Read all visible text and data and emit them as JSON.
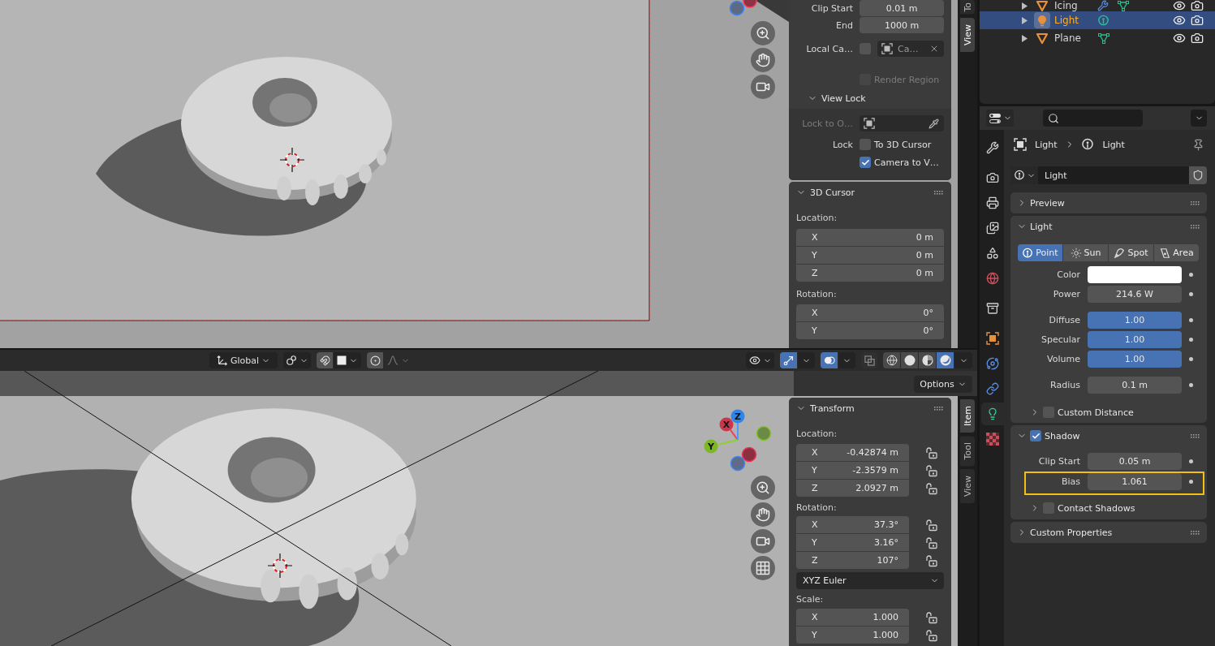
{
  "top_viewport": {
    "sidebar_tabs": [
      {
        "label": "To",
        "selected": false
      },
      {
        "label": "View",
        "selected": true
      }
    ],
    "view_panel": {
      "rows": [
        {
          "kind": "number",
          "label": "Clip Start",
          "value": "0.01 m"
        },
        {
          "kind": "number",
          "label": "End",
          "value": "1000 m"
        },
        {
          "kind": "object",
          "label": "Local Ca…",
          "checked": false,
          "value": "Ca…"
        },
        {
          "kind": "check",
          "text": "Render Region",
          "checked": false,
          "disabled": true
        }
      ],
      "subpanel": {
        "title": "View Lock",
        "expanded": true,
        "rows": [
          {
            "kind": "picker",
            "label": "Lock to O…",
            "disabled": true
          },
          {
            "kind": "check",
            "label": "Lock",
            "text": "To 3D Cursor",
            "checked": false,
            "disabled": false
          },
          {
            "kind": "check",
            "text": "Camera to V…",
            "checked": true,
            "disabled": false
          }
        ]
      }
    },
    "cursor_panel": {
      "title": "3D Cursor",
      "expanded": true,
      "groups": [
        {
          "label": "Location:",
          "fields": [
            {
              "axis": "X",
              "value": "0 m"
            },
            {
              "axis": "Y",
              "value": "0 m"
            },
            {
              "axis": "Z",
              "value": "0 m"
            }
          ]
        },
        {
          "label": "Rotation:",
          "fields": [
            {
              "axis": "X",
              "value": "0°"
            },
            {
              "axis": "Y",
              "value": "0°"
            }
          ]
        }
      ]
    }
  },
  "bottom_viewport": {
    "header": {
      "orientation": "Global",
      "snap": false,
      "proportional_editing": false,
      "gizmos": true,
      "overlays": true,
      "xray": false,
      "shading": [
        {
          "kind": "wireframe",
          "selected": false
        },
        {
          "kind": "solid",
          "selected": false
        },
        {
          "kind": "material",
          "selected": false
        },
        {
          "kind": "rendered",
          "selected": true
        }
      ]
    },
    "options_button": "Options",
    "gizmo": {
      "labels": [
        "X",
        "Y",
        "Z"
      ]
    },
    "sidebar_tabs": [
      {
        "label": "Item",
        "selected": true
      },
      {
        "label": "Tool",
        "selected": false
      },
      {
        "label": "View",
        "selected": false
      }
    ],
    "transform_panel": {
      "title": "Transform",
      "expanded": true,
      "groups": [
        {
          "label": "Location:",
          "fields": [
            {
              "axis": "X",
              "value": "-0.42874 m",
              "locked": false
            },
            {
              "axis": "Y",
              "value": "-2.3579 m",
              "locked": false
            },
            {
              "axis": "Z",
              "value": "2.0927 m",
              "locked": false
            }
          ]
        },
        {
          "label": "Rotation:",
          "fields": [
            {
              "axis": "X",
              "value": "37.3°",
              "locked": false
            },
            {
              "axis": "Y",
              "value": "3.16°",
              "locked": false
            },
            {
              "axis": "Z",
              "value": "107°",
              "locked": false
            }
          ],
          "mode": "XYZ Euler"
        },
        {
          "label": "Scale:",
          "fields": [
            {
              "axis": "X",
              "value": "1.000",
              "locked": false
            },
            {
              "axis": "Y",
              "value": "1.000",
              "locked": false
            }
          ]
        }
      ]
    }
  },
  "outliner": {
    "rows": [
      {
        "name": "Icing",
        "kind": "mesh",
        "selected": false,
        "expanded": false,
        "modifier": true
      },
      {
        "name": "Light",
        "kind": "light",
        "selected": true,
        "expanded": false,
        "modifier": false
      },
      {
        "name": "Plane",
        "kind": "mesh",
        "selected": false,
        "expanded": false,
        "modifier": false
      }
    ]
  },
  "properties": {
    "tabs": [
      {
        "kind": "tool",
        "selected": false
      },
      {
        "kind": "render",
        "selected": false
      },
      {
        "kind": "output",
        "selected": false
      },
      {
        "kind": "view_layer",
        "selected": false
      },
      {
        "kind": "scene",
        "selected": false
      },
      {
        "kind": "world",
        "selected": false
      },
      {
        "kind": "collection",
        "selected": false
      },
      {
        "kind": "object",
        "selected": false
      },
      {
        "kind": "physics",
        "selected": false
      },
      {
        "kind": "constraints",
        "selected": false
      },
      {
        "kind": "light",
        "selected": true
      },
      {
        "kind": "texture",
        "selected": false
      }
    ],
    "breadcrumb": [
      {
        "kind": "object",
        "label": "Light"
      },
      {
        "kind": "light",
        "label": "Light"
      }
    ],
    "datablock": {
      "name": "Light"
    },
    "panels": [
      {
        "title": "Preview",
        "expanded": false
      },
      {
        "title": "Light",
        "expanded": true,
        "types": [
          {
            "kind": "point",
            "label": "Point",
            "selected": true
          },
          {
            "kind": "sun",
            "label": "Sun",
            "selected": false
          },
          {
            "kind": "spot",
            "label": "Spot",
            "selected": false
          },
          {
            "kind": "area",
            "label": "Area",
            "selected": false
          }
        ],
        "groups": [
          {
            "fields": [
              {
                "kind": "color",
                "label": "Color",
                "color": "#ffffff"
              },
              {
                "kind": "number",
                "label": "Power",
                "value": "214.6 W"
              }
            ]
          },
          {
            "fields": [
              {
                "kind": "slider",
                "label": "Diffuse",
                "value": "1.00",
                "level": 1
              },
              {
                "kind": "slider",
                "label": "Specular",
                "value": "1.00",
                "level": 1
              },
              {
                "kind": "slider",
                "label": "Volume",
                "value": "1.00",
                "level": 1
              }
            ]
          },
          {
            "fields": [
              {
                "kind": "number",
                "label": "Radius",
                "value": "0.1 m"
              }
            ]
          }
        ],
        "subpanels": [
          {
            "title": "Custom Distance",
            "expanded": false,
            "checked": false
          }
        ]
      },
      {
        "title": "Shadow",
        "expanded": true,
        "checked": true,
        "groups": [
          {
            "fields": [
              {
                "kind": "number",
                "label": "Clip Start",
                "value": "0.05 m",
                "highlighted": false
              },
              {
                "kind": "number",
                "label": "Bias",
                "value": "1.061",
                "highlighted": true
              }
            ]
          }
        ],
        "subpanels": [
          {
            "title": "Contact Shadows",
            "expanded": false,
            "checked": false
          }
        ]
      },
      {
        "title": "Custom Properties",
        "expanded": false
      }
    ]
  }
}
